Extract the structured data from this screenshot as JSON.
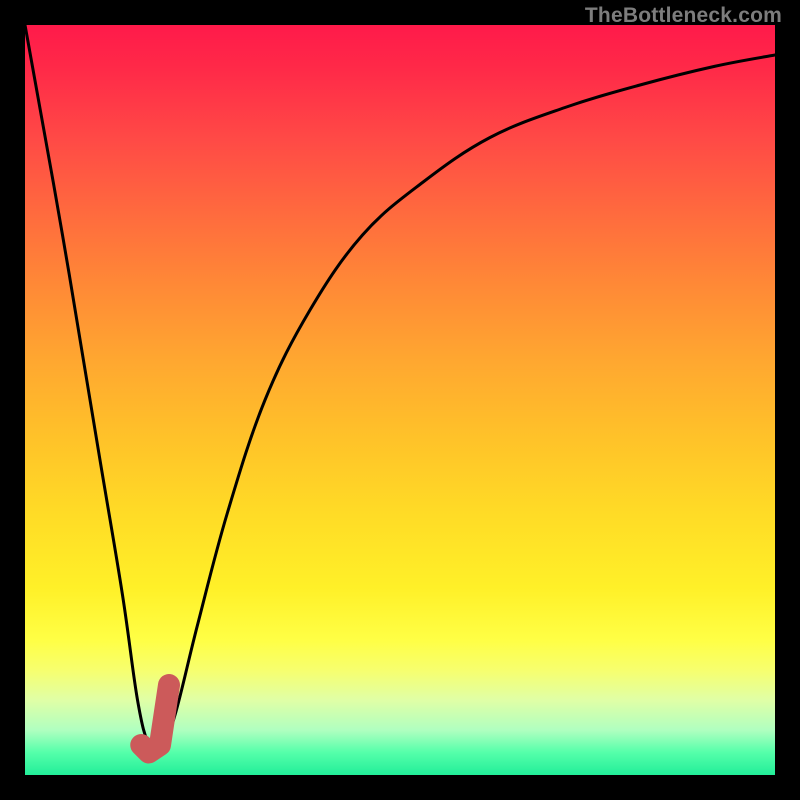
{
  "watermark": "TheBottleneck.com",
  "chart_data": {
    "type": "line",
    "title": "",
    "xlabel": "",
    "ylabel": "",
    "xlim": [
      0,
      100
    ],
    "ylim": [
      0,
      100
    ],
    "grid": false,
    "legend": false,
    "series": [
      {
        "name": "bottleneck-curve",
        "x": [
          0,
          5,
          10,
          13,
          15,
          16.5,
          18,
          20,
          23,
          27,
          32,
          38,
          45,
          53,
          62,
          72,
          82,
          92,
          100
        ],
        "y": [
          100,
          72,
          42,
          24,
          10,
          4,
          3,
          8,
          20,
          35,
          50,
          62,
          72,
          79,
          85,
          89,
          92,
          94.5,
          96
        ]
      },
      {
        "name": "marker-j",
        "x": [
          15.5,
          16.5,
          18,
          19.2
        ],
        "y": [
          4,
          3,
          4,
          12
        ]
      }
    ],
    "background_gradient": {
      "orientation": "vertical",
      "stops": [
        {
          "pos": 0.0,
          "color": "#ff1a4a"
        },
        {
          "pos": 0.35,
          "color": "#ff8a36"
        },
        {
          "pos": 0.7,
          "color": "#ffe627"
        },
        {
          "pos": 0.92,
          "color": "#c6ffb0"
        },
        {
          "pos": 1.0,
          "color": "#22ee99"
        }
      ]
    }
  }
}
